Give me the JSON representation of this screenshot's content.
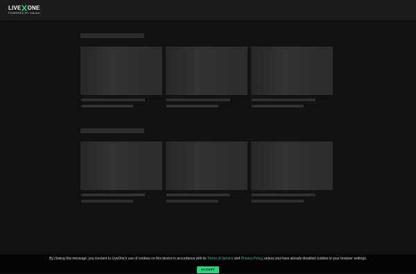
{
  "header": {
    "logo_left": "LIVE",
    "logo_right": "ONE",
    "logo_tagline": "POWERED BY slacker"
  },
  "colors": {
    "brand_x": "#2fcf7e",
    "accent": "#2fcf7e",
    "background": "#121212"
  },
  "cookie_banner": {
    "text_before": "By closing this message, you consent to LiveOne's use of cookies on this device in accordance with its ",
    "terms_link": "Terms of Service",
    "text_and": " and ",
    "privacy_link": "Privacy Policy",
    "text_after": ", unless you have already disabled cookies in your browser settings.",
    "accept_label": "ACCEPT"
  }
}
